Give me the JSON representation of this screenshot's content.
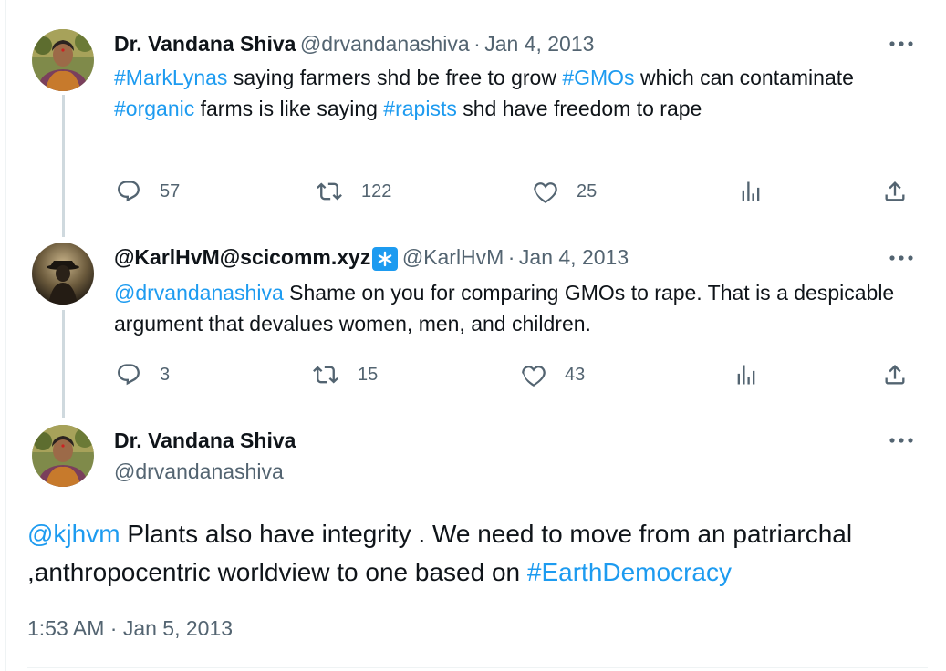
{
  "tweet1": {
    "name": "Dr. Vandana Shiva",
    "handle": "@drvandanashiva",
    "sep": "·",
    "date": "Jan 4, 2013",
    "text_parts": [
      {
        "text": "#MarkLynas",
        "link": true
      },
      {
        "text": " saying farmers shd be free to grow ",
        "link": false
      },
      {
        "text": "#GMOs",
        "link": true
      },
      {
        "text": " which can contaminate ",
        "link": false
      },
      {
        "text": "#organic",
        "link": true
      },
      {
        "text": " farms is like saying ",
        "link": false
      },
      {
        "text": "#rapists",
        "link": true
      },
      {
        "text": " shd have freedom to rape",
        "link": false
      }
    ],
    "replies": "57",
    "retweets": "122",
    "likes": "25"
  },
  "tweet2": {
    "name": "@KarlHvM@scicomm.xyz",
    "badge_icon": "asterisk-icon",
    "handle": "@KarlHvM",
    "sep": "·",
    "date": "Jan 4, 2013",
    "text_parts": [
      {
        "text": "@drvandanashiva",
        "link": true
      },
      {
        "text": " Shame on you for comparing GMOs to rape. That is a despicable argument that devalues women, men, and children.",
        "link": false
      }
    ],
    "replies": "3",
    "retweets": "15",
    "likes": "43"
  },
  "tweet3": {
    "name": "Dr. Vandana Shiva",
    "handle": "@drvandanashiva",
    "text_parts": [
      {
        "text": "@kjhvm",
        "link": true
      },
      {
        "text": "  Plants also have integrity . We need to move from an patriarchal ,anthropocentric worldview to one based on ",
        "link": false
      },
      {
        "text": "#EarthDemocracy",
        "link": true
      }
    ],
    "timestamp": "1:53 AM · Jan 5, 2013"
  },
  "colors": {
    "link": "#1d9bf0",
    "secondary_text": "#536471",
    "primary_text": "#0f1419",
    "thread_line": "#cfd9de"
  },
  "icons": {
    "reply": "reply-icon",
    "retweet": "retweet-icon",
    "like": "heart-icon",
    "views": "views-icon",
    "share": "share-icon",
    "more": "more-icon"
  }
}
